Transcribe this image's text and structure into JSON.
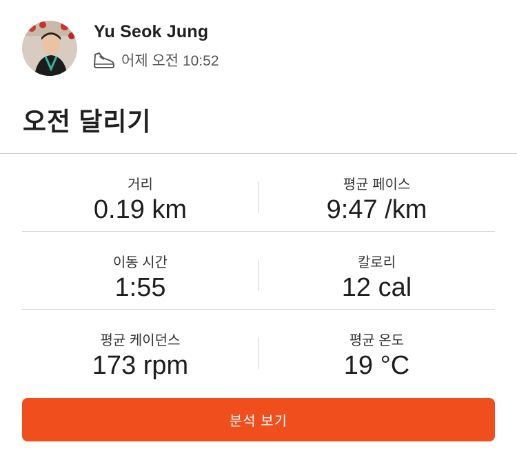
{
  "header": {
    "user_name": "Yu Seok Jung",
    "activity_time": "어제 오전 10:52",
    "activity_icon": "running-shoe-icon",
    "title": "오전 달리기"
  },
  "stats": [
    {
      "label": "거리",
      "value": "0.19 km"
    },
    {
      "label": "평균 페이스",
      "value": "9:47 /km"
    },
    {
      "label": "이동 시간",
      "value": "1:55"
    },
    {
      "label": "칼로리",
      "value": "12 cal"
    },
    {
      "label": "평균 케이던스",
      "value": "173 rpm"
    },
    {
      "label": "평균 온도",
      "value": "19 °C"
    }
  ],
  "actions": {
    "analysis_button_label": "분석 보기"
  },
  "colors": {
    "accent": "#f04e1c",
    "divider": "#d6d6d6",
    "text_primary": "#1f1f1f"
  }
}
